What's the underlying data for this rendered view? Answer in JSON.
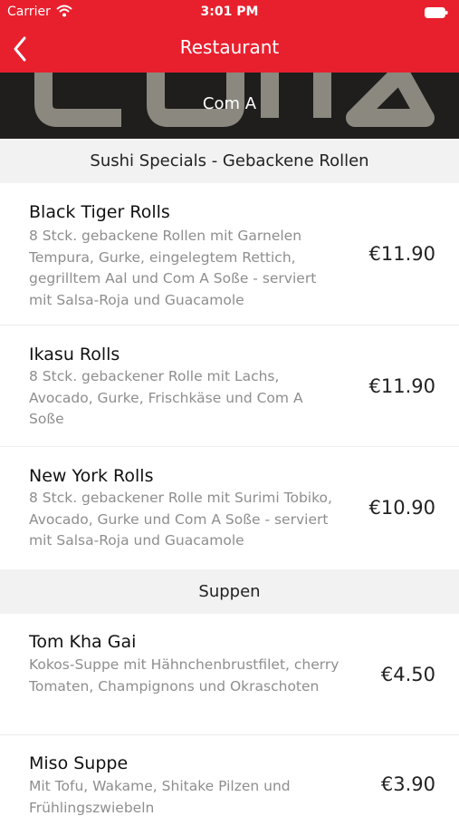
{
  "status_bar": {
    "carrier": "Carrier",
    "time": "3:01 PM"
  },
  "nav": {
    "title": "Restaurant"
  },
  "banner": {
    "title": "Com A"
  },
  "sections": [
    {
      "title": "Sushi Specials - Gebackene Rollen",
      "items": [
        {
          "name": "Black Tiger Rolls",
          "description": "8 Stck. gebackene Rollen mit Garnelen Tempura, Gurke, eingelegtem Rettich, gegrilltem Aal und Com A Soße - serviert mit Salsa-Roja und Guacamole",
          "price": "€11.90"
        },
        {
          "name": "Ikasu Rolls",
          "description": "8 Stck. gebackener Rolle mit Lachs, Avocado, Gurke, Frischkäse und Com A Soße",
          "price": "€11.90"
        },
        {
          "name": "New York Rolls",
          "description": "8 Stck. gebackener Rolle mit Surimi Tobiko, Avocado, Gurke und Com A Soße - serviert mit Salsa-Roja und Guacamole",
          "price": "€10.90"
        }
      ]
    },
    {
      "title": "Suppen",
      "items": [
        {
          "name": "Tom Kha Gai",
          "description": "Kokos-Suppe mit Hähnchenbrustfilet, cherry Tomaten, Champignons und Okraschoten",
          "price": "€4.50"
        },
        {
          "name": "Miso Suppe",
          "description": "Mit Tofu, Wakame, Shitake Pilzen und Frühlingszwiebeln",
          "price": "€3.90"
        }
      ]
    }
  ],
  "colors": {
    "brand": "#e8202e",
    "banner_bg": "#1f1e1c",
    "section_bg": "#f2f2f2",
    "description": "#8e8e8e"
  }
}
